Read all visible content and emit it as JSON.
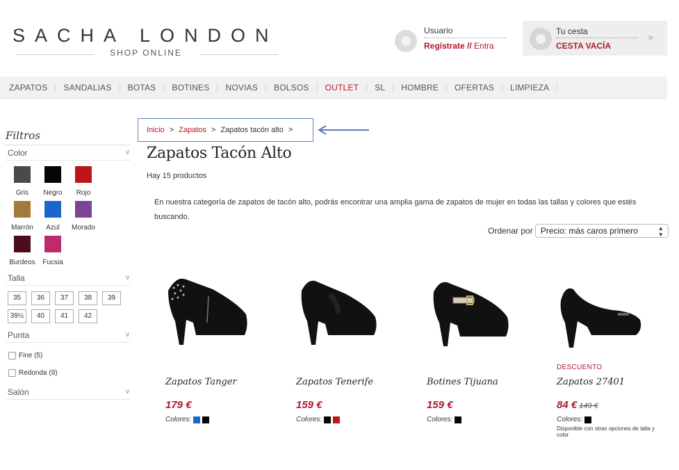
{
  "header": {
    "logo_main": "SACHA LONDON",
    "logo_sub": "SHOP ONLINE",
    "user_label": "Usuario",
    "register_label": "Regístrate",
    "link_sep": "//",
    "login_label": "Entra",
    "cart_label": "Tu cesta",
    "cart_value": "CESTA VACÍA"
  },
  "nav": [
    "ZAPATOS",
    "SANDALIAS",
    "BOTAS",
    "BOTINES",
    "NOVIAS",
    "BOLSOS",
    "OUTLET",
    "SL",
    "HOMBRE",
    "OFERTAS",
    "LIMPIEZA"
  ],
  "sidebar": {
    "title": "Filtros",
    "color_label": "Color",
    "colors": [
      {
        "name": "Gris",
        "hex": "#4a4a4a"
      },
      {
        "name": "Negro",
        "hex": "#050505"
      },
      {
        "name": "Rojo",
        "hex": "#c0141b"
      },
      {
        "name": "Marrón",
        "hex": "#a27a3e"
      },
      {
        "name": "Azul",
        "hex": "#1a66c9"
      },
      {
        "name": "Morado",
        "hex": "#7a4497"
      },
      {
        "name": "Burdeos",
        "hex": "#4c0c1c"
      },
      {
        "name": "Fucsia",
        "hex": "#bf2a6e"
      }
    ],
    "size_label": "Talla",
    "sizes": [
      "35",
      "36",
      "37",
      "38",
      "39",
      "39½",
      "40",
      "41",
      "42"
    ],
    "toe_label": "Punta",
    "toe_options": [
      "Fine (5)",
      "Redonda (9)"
    ],
    "heel_label": "Salón",
    "chevron": "v"
  },
  "breadcrumb": {
    "home": "Inicio",
    "category": "Zapatos",
    "current": "Zapatos tacón alto",
    "sep": ">"
  },
  "page": {
    "title": "Zapatos Tacón Alto",
    "count": "Hay 15 productos",
    "description": "En nuestra categoría de zapatos de tacón alto, podrás encontrar una amplia gama de zapatos de mujer en todas las tallas y colores que estés buscando.",
    "sort_label": "Ordenar por",
    "sort_value": "Precio: más caros primero"
  },
  "products": [
    {
      "name": "Zapatos Tanger",
      "price": "179 €",
      "colors_label": "Colores:",
      "colors": [
        "#1a66c9",
        "#050505"
      ]
    },
    {
      "name": "Zapatos Tenerife",
      "price": "159 €",
      "colors_label": "Colores:",
      "colors": [
        "#050505",
        "#c0141b"
      ]
    },
    {
      "name": "Botines Tijuana",
      "price": "159 €",
      "colors_label": "Colores:",
      "colors": [
        "#050505"
      ]
    },
    {
      "name": "Zapatos 27401",
      "promo": "DESCUENTO",
      "price": "84 €",
      "old_price": "149 €",
      "colors_label": "Colores:",
      "colors": [
        "#050505"
      ],
      "note": "Disponible con otras opciones de talla y color"
    }
  ],
  "accent_color": "#b0182c"
}
